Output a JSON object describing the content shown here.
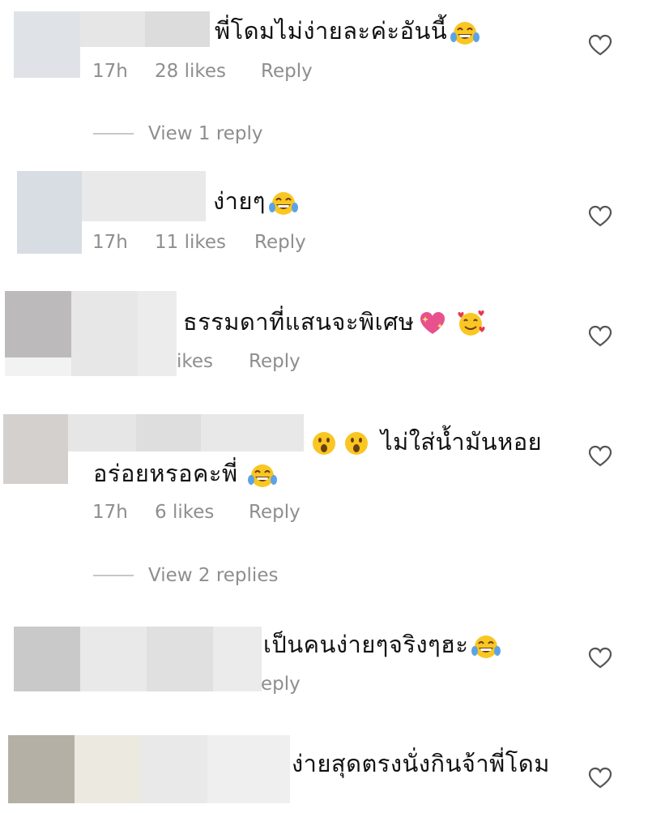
{
  "comments": [
    {
      "text": "พี่โดมไม่ง่ายละค่ะอันนี้",
      "emojis": [
        "face-with-tears-of-joy-icon"
      ],
      "time": "17h",
      "likes": "28 likes",
      "reply": "Reply",
      "view_replies": "View 1 reply"
    },
    {
      "text": "ง่ายๆ",
      "emojis": [
        "face-with-tears-of-joy-icon"
      ],
      "time": "17h",
      "likes": "11 likes",
      "reply": "Reply"
    },
    {
      "text": "ธรรมดาที่แสนจะพิเศษ",
      "emojis": [
        "sparkling-heart-icon",
        "smiling-face-with-hearts-icon"
      ],
      "likes_partial": "ikes",
      "reply": "Reply"
    },
    {
      "text_line1": "ไม่ใส่น้ำมันหอย",
      "text_line2": "อร่อยหรอคะพี่",
      "emojis": [
        "hushed-face-icon",
        "hushed-face-icon",
        "face-with-tears-of-joy-icon"
      ],
      "time": "17h",
      "likes": "6 likes",
      "reply": "Reply",
      "view_replies": "View 2 replies"
    },
    {
      "text": "เป็นคนง่ายๆจริงๆฮะ",
      "emojis": [
        "face-with-tears-of-joy-icon"
      ],
      "reply_partial": "eply"
    },
    {
      "text": "ง่ายสุดตรงนั่งกินจ้าพี่โดม",
      "emojis": []
    }
  ],
  "colors": {
    "secondary_text": "#8e8e8e",
    "primary_text": "#111111",
    "divider": "#c7c7c7",
    "blur_light": "#e4e4e4"
  }
}
